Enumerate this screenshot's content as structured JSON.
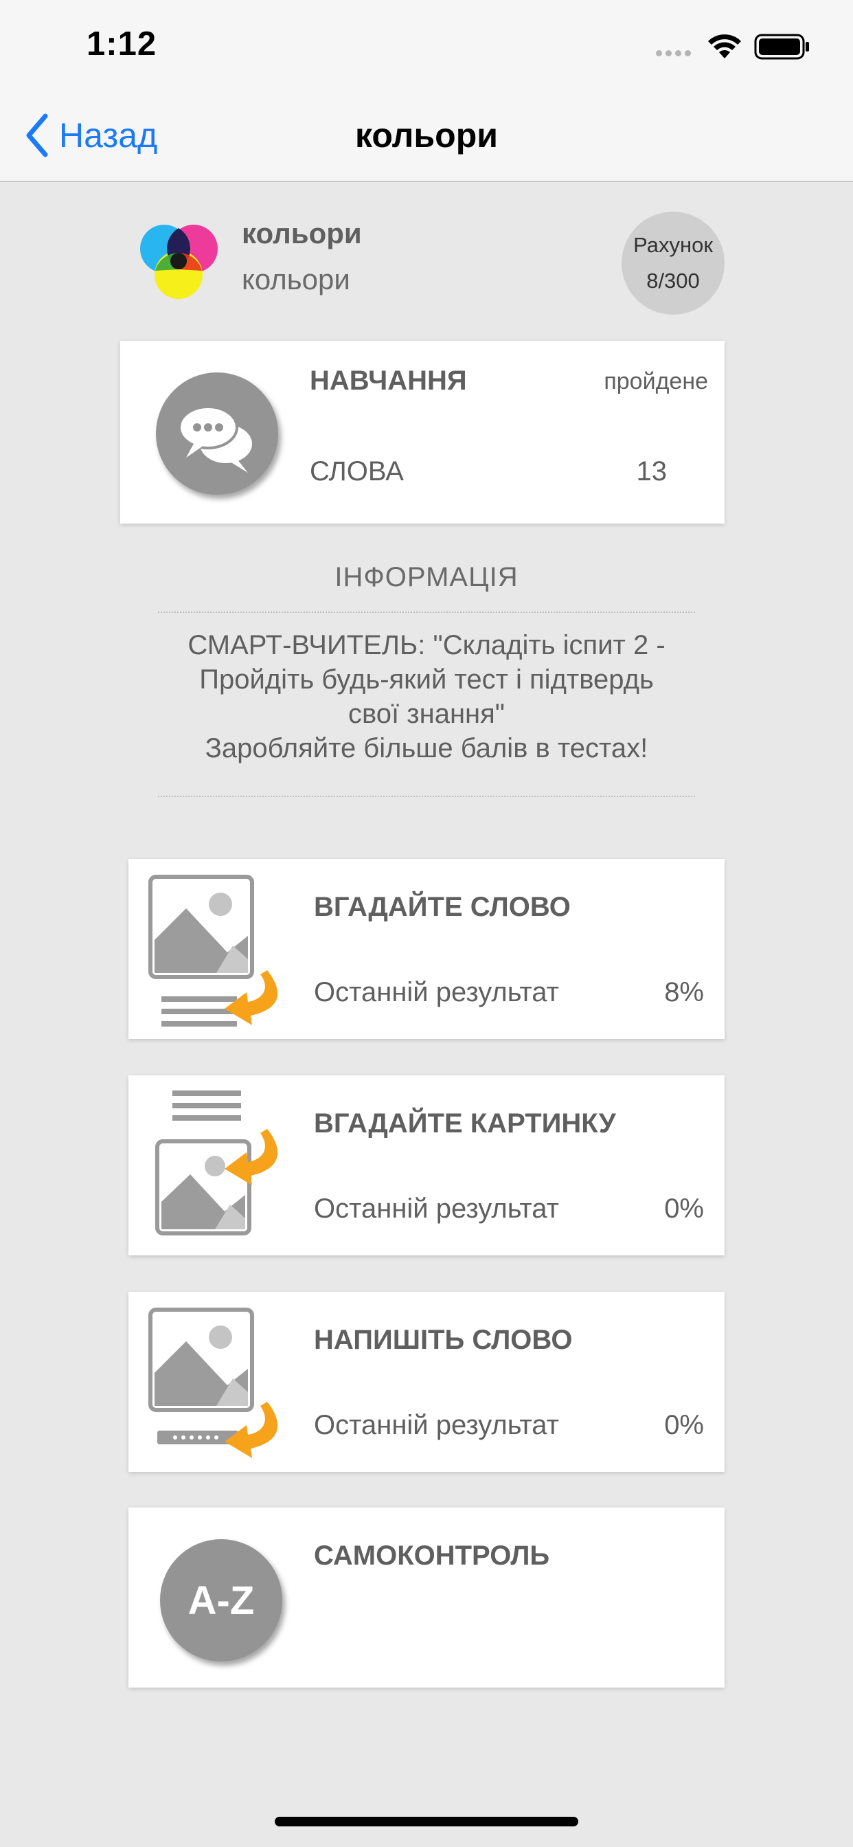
{
  "status_bar": {
    "time": "1:12"
  },
  "nav": {
    "back_label": "Назад",
    "title": "кольори"
  },
  "header": {
    "title": "кольори",
    "subtitle": "кольори",
    "score_label": "Рахунок",
    "score_value": "8/300"
  },
  "learning": {
    "title": "НАВЧАННЯ",
    "status": "пройдене",
    "words_label": "СЛОВА",
    "words_count": "13"
  },
  "info": {
    "heading": "ІНФОРМАЦІЯ",
    "text": "СМАРТ-ВЧИТЕЛЬ: \"Складіть іспит 2 -\nПройдіть будь-який тест і підтвердь\nсвої знання\"\nЗаробляйте більше балів в тестах!"
  },
  "tests": [
    {
      "title": "ВГАДАЙТЕ СЛОВО",
      "result_label": "Останній результат",
      "result_value": "8%",
      "icon": "image-to-word-icon"
    },
    {
      "title": "ВГАДАЙТЕ КАРТИНКУ",
      "result_label": "Останній результат",
      "result_value": "0%",
      "icon": "word-to-image-icon"
    },
    {
      "title": "НАПИШІТЬ СЛОВО",
      "result_label": "Останній результат",
      "result_value": "0%",
      "icon": "image-to-typing-icon"
    }
  ],
  "self_control": {
    "title": "САМОКОНТРОЛЬ",
    "icon_text": "A-Z"
  },
  "colors": {
    "accent": "#1b7af5",
    "arrow": "#f7a21b",
    "icon_gray": "#949494"
  }
}
